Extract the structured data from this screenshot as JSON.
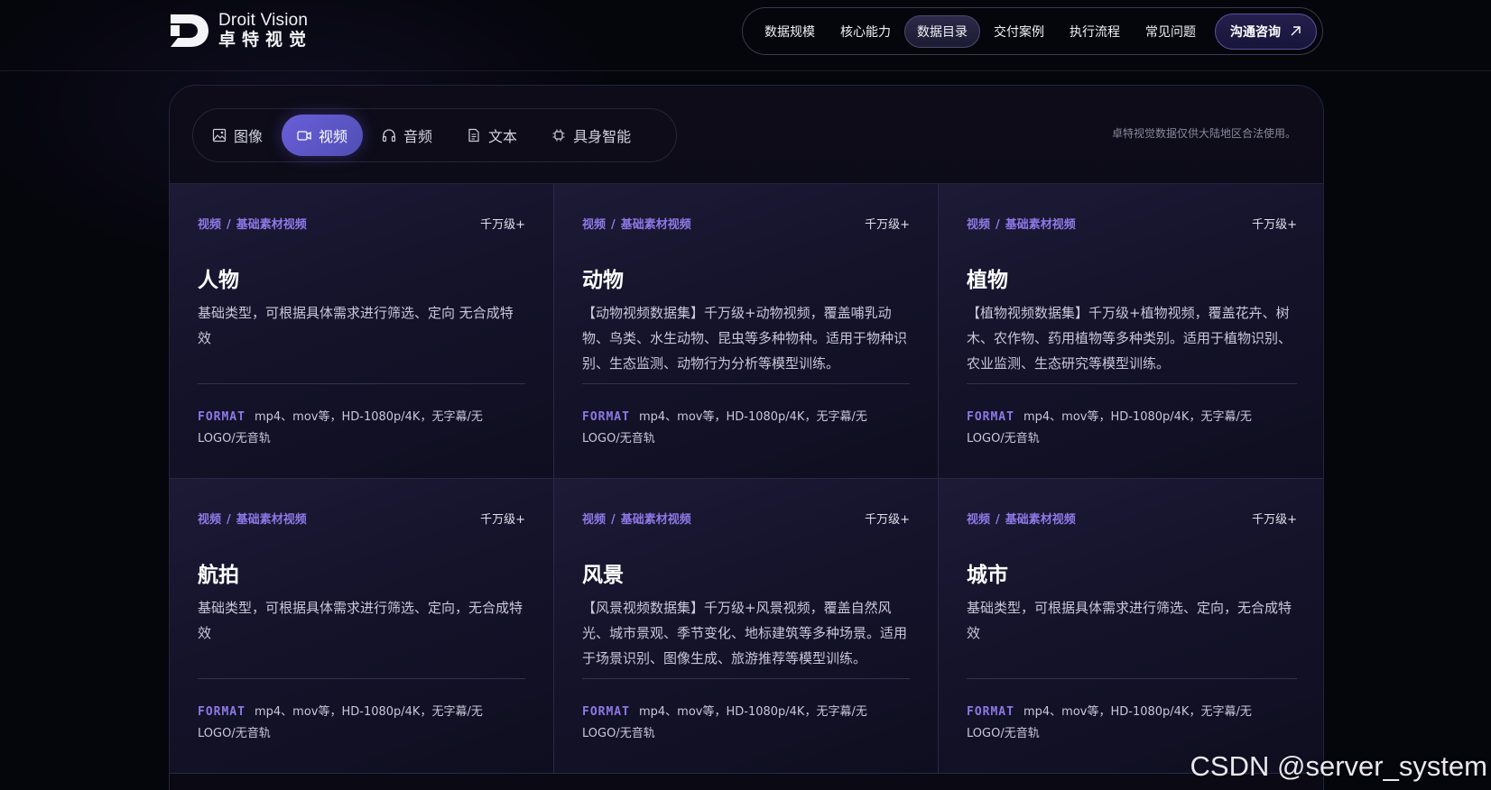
{
  "brand": {
    "name_en": "Droit Vision",
    "name_cn": "卓特视觉"
  },
  "nav": {
    "items": [
      {
        "label": "数据规模",
        "active": false
      },
      {
        "label": "核心能力",
        "active": false
      },
      {
        "label": "数据目录",
        "active": true
      },
      {
        "label": "交付案例",
        "active": false
      },
      {
        "label": "执行流程",
        "active": false
      },
      {
        "label": "常见问题",
        "active": false
      }
    ],
    "cta": {
      "label": "沟通咨询",
      "icon": "arrow-up-right-icon"
    }
  },
  "tabs": [
    {
      "label": "图像",
      "icon": "image-icon",
      "active": false
    },
    {
      "label": "视频",
      "icon": "video-icon",
      "active": true
    },
    {
      "label": "音频",
      "icon": "headphones-icon",
      "active": false
    },
    {
      "label": "文本",
      "icon": "document-icon",
      "active": false
    },
    {
      "label": "具身智能",
      "icon": "chip-icon",
      "active": false
    }
  ],
  "notice": "卓特视觉数据仅供大陆地区合法使用。",
  "cards": [
    {
      "category": "视频",
      "subcategory": "基础素材视频",
      "scale": "千万级+",
      "title": "人物",
      "desc": "基础类型，可根据具体需求进行筛选、定向 无合成特效",
      "format_label": "FORMAT",
      "format": "mp4、mov等，HD-1080p/4K，无字幕/无LOGO/无音轨"
    },
    {
      "category": "视频",
      "subcategory": "基础素材视频",
      "scale": "千万级+",
      "title": "动物",
      "desc": "【动物视频数据集】千万级+动物视频，覆盖哺乳动物、鸟类、水生动物、昆虫等多种物种。适用于物种识别、生态监测、动物行为分析等模型训练。",
      "format_label": "FORMAT",
      "format": "mp4、mov等，HD-1080p/4K，无字幕/无LOGO/无音轨"
    },
    {
      "category": "视频",
      "subcategory": "基础素材视频",
      "scale": "千万级+",
      "title": "植物",
      "desc": "【植物视频数据集】千万级+植物视频，覆盖花卉、树木、农作物、药用植物等多种类别。适用于植物识别、农业监测、生态研究等模型训练。",
      "format_label": "FORMAT",
      "format": "mp4、mov等，HD-1080p/4K，无字幕/无LOGO/无音轨"
    },
    {
      "category": "视频",
      "subcategory": "基础素材视频",
      "scale": "千万级+",
      "title": "航拍",
      "desc": "基础类型，可根据具体需求进行筛选、定向，无合成特效",
      "format_label": "FORMAT",
      "format": "mp4、mov等，HD-1080p/4K，无字幕/无LOGO/无音轨"
    },
    {
      "category": "视频",
      "subcategory": "基础素材视频",
      "scale": "千万级+",
      "title": "风景",
      "desc": "【风景视频数据集】千万级+风景视频，覆盖自然风光、城市景观、季节变化、地标建筑等多种场景。适用于场景识别、图像生成、旅游推荐等模型训练。",
      "format_label": "FORMAT",
      "format": "mp4、mov等，HD-1080p/4K，无字幕/无LOGO/无音轨"
    },
    {
      "category": "视频",
      "subcategory": "基础素材视频",
      "scale": "千万级+",
      "title": "城市",
      "desc": "基础类型，可根据具体需求进行筛选、定向，无合成特效",
      "format_label": "FORMAT",
      "format": "mp4、mov等，HD-1080p/4K，无字幕/无LOGO/无音轨"
    }
  ],
  "crumb_separator": "/",
  "watermark": "CSDN @server_system",
  "colors": {
    "accent": "#8e78e6",
    "tab_active": "#6a5ed8",
    "background": "#05050c"
  }
}
